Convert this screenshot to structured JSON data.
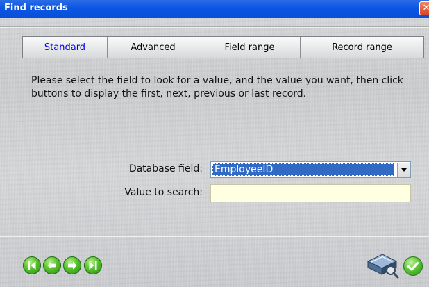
{
  "window": {
    "title": "Find records",
    "close_glyph": "✕"
  },
  "tabs": [
    {
      "label": "Standard",
      "active": true
    },
    {
      "label": "Advanced",
      "active": false
    },
    {
      "label": "Field range",
      "active": false
    },
    {
      "label": "Record range",
      "active": false
    }
  ],
  "instructions": "Please select the field to look for a value, and the value you want, then click buttons to display the first, next, previous or last record.",
  "form": {
    "database_field_label": "Database field:",
    "database_field_value": "EmployeeID",
    "value_to_search_label": "Value to search:",
    "value_to_search_value": ""
  },
  "icons": {
    "first": "first-record-icon",
    "previous": "previous-record-icon",
    "next": "next-record-icon",
    "last": "last-record-icon",
    "database": "database-search-icon",
    "ok": "checkmark-icon"
  },
  "colors": {
    "titlebar": "#0a56e4",
    "selection": "#316ac5",
    "input_background": "#ffffe1",
    "nav_green": "#55c12b",
    "active_tab_link": "#0000ee"
  }
}
